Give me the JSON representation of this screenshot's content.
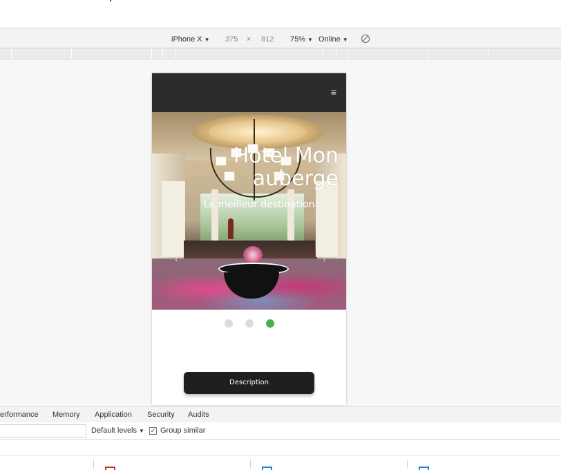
{
  "device_toolbar": {
    "device": "iPhone X",
    "width": "375",
    "times": "×",
    "height": "812",
    "zoom": "75%",
    "network": "Online",
    "rotate_icon": "rotate-icon"
  },
  "phone": {
    "menu_icon": "≡",
    "hero_title_line1": "Hotel Mon",
    "hero_title_line2": "auberge",
    "hero_subtitle": "Le meilleur destination.",
    "arrow_left": "‹",
    "arrow_right": "›",
    "indicators": [
      {
        "active": false
      },
      {
        "active": false
      },
      {
        "active": true
      }
    ],
    "indicator_active_color": "#4caf50",
    "indicator_color": "#dcdcdc",
    "description_button": "Description"
  },
  "devtools": {
    "tabs": [
      "erformance",
      "Memory",
      "Application",
      "Security",
      "Audits"
    ],
    "levels_label": "Default levels",
    "group_similar_label": "Group similar",
    "group_similar_checked": true
  }
}
